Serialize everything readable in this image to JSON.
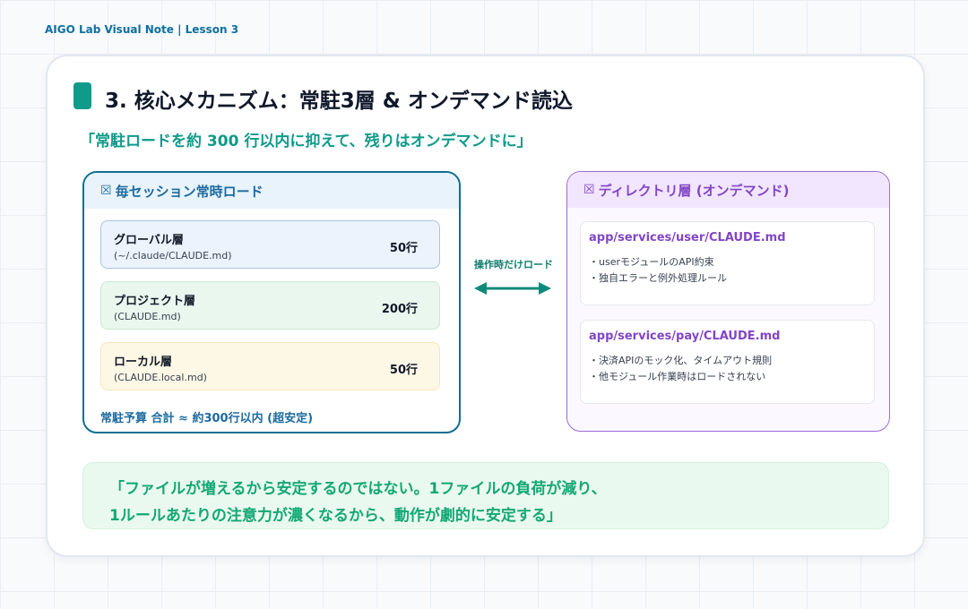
{
  "header": {
    "label": "AIGO Lab Visual Note | Lesson 3"
  },
  "card": {
    "title": "3. 核心メカニズム：常駐3層 & オンデマンド読込",
    "subtitle": "「常駐ロードを約 300 行以内に抑えて、残りはオンデマンドに」"
  },
  "left_panel": {
    "header_icon": "☒",
    "header": "毎セッション常時ロード",
    "layers": [
      {
        "name": "グローバル層",
        "path": "(~/.claude/CLAUDE.md)",
        "lines": "50行"
      },
      {
        "name": "プロジェクト層",
        "path": "(CLAUDE.md)",
        "lines": "200行"
      },
      {
        "name": "ローカル層",
        "path": "(CLAUDE.local.md)",
        "lines": "50行"
      }
    ],
    "budget": "常駐予算 合計 ≈ 約300行以内 (超安定)"
  },
  "connector": {
    "label": "操作時だけロード"
  },
  "right_panel": {
    "header_icon": "☒",
    "header": "ディレクトリ層 (オンデマンド)",
    "files": [
      {
        "path": "app/services/user/CLAUDE.md",
        "notes": [
          "・userモジュールのAPI約束",
          "・独自エラーと例外処理ルール"
        ]
      },
      {
        "path": "app/services/pay/CLAUDE.md",
        "notes": [
          "・決済APIのモック化、タイムアウト規則",
          "・他モジュール作業時はロードされない"
        ]
      }
    ]
  },
  "quote": {
    "line1": "「ファイルが増えるから安定するのではない。1ファイルの負荷が減り、",
    "line2": "1ルールあたりの注意力が濃くなるから、動作が劇的に安定する」"
  },
  "colors": {
    "accent_teal": "#0f9a8a",
    "left_blue": "#1c6aa0",
    "right_purple": "#8345c8",
    "quote_green": "#13a874"
  }
}
